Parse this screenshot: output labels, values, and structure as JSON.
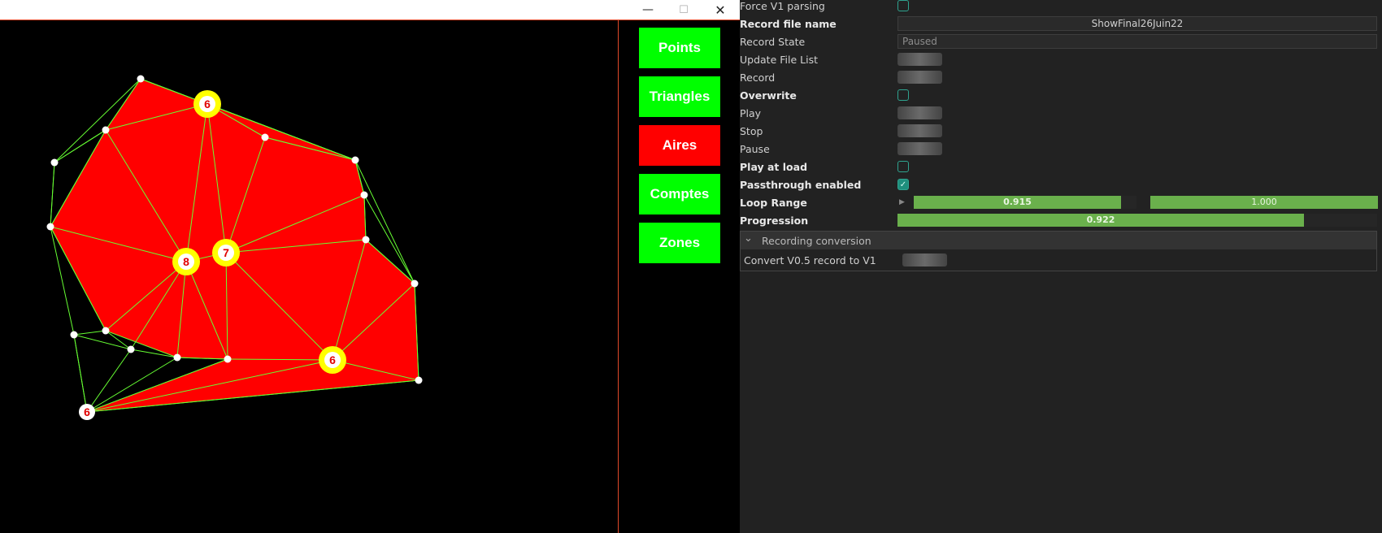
{
  "window": {
    "minimize_glyph": "—",
    "maximize_glyph": "☐",
    "close_glyph": "✕"
  },
  "side_buttons": [
    {
      "label": "Points",
      "color": "#00ff00"
    },
    {
      "label": "Triangles",
      "color": "#00ff00"
    },
    {
      "label": "Aires",
      "color": "#ff0000"
    },
    {
      "label": "Comptes",
      "color": "#00ff00"
    },
    {
      "label": "Zones",
      "color": "#00ff00"
    }
  ],
  "canvas": {
    "fill_color": "#ff0000",
    "edge_color": "#66ff33",
    "point_color": "#ffffff",
    "highlight_color": "#ffff00",
    "count_labels": [
      "6",
      "8",
      "7",
      "6",
      "6"
    ]
  },
  "inspector": {
    "force_v1_label": "Force V1 parsing",
    "record_file_name_label": "Record file name",
    "record_file_name_value": "ShowFinal26Juin22",
    "record_state_label": "Record State",
    "record_state_value": "Paused",
    "update_file_list_label": "Update File List",
    "record_label": "Record",
    "overwrite_label": "Overwrite",
    "play_label": "Play",
    "stop_label": "Stop",
    "pause_label": "Pause",
    "play_at_load_label": "Play at load",
    "passthrough_label": "Passthrough enabled",
    "passthrough_checked": true,
    "loop_range_label": "Loop Range",
    "loop_range_start": "0.915",
    "loop_range_end": "1.000",
    "progression_label": "Progression",
    "progression_value": "0.922",
    "progression_fraction": 0.922,
    "conversion_title": "Recording conversion",
    "convert_label": "Convert V0.5 record to V1",
    "check_glyph": "✓",
    "arrow_glyph": "▶",
    "chevron_glyph": "⌄"
  }
}
